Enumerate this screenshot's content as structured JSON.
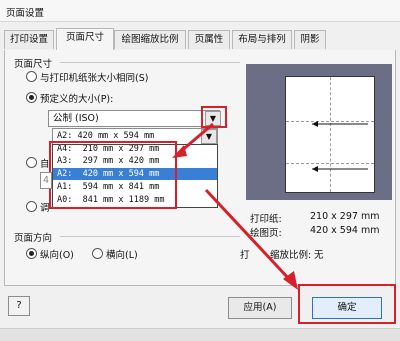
{
  "window": {
    "title": "页面设置"
  },
  "tabs": [
    "打印设置",
    "页面尺寸",
    "绘图缩放比例",
    "页属性",
    "布局与排列",
    "阴影"
  ],
  "active_tab_index": 1,
  "page_size": {
    "group_label": "页面尺寸",
    "option_same_as_printer": "与打印机纸张大小相同(S)",
    "option_predefined": "预定义的大小(P):",
    "predefined_selected": true,
    "standard_combo_value": "公制 (ISO)",
    "size_combo_value": "A2:  420 mm x 594 mm",
    "size_options": [
      "A4:  210 mm x 297 mm",
      "A3:  297 mm x 420 mm",
      "A2:  420 mm x 594 mm",
      "A1:  594 mm x 841 mm",
      "A0:  841 mm x 1189 mm"
    ],
    "selected_option_index": 2,
    "option_custom_prefix": "自",
    "custom_field_prefix": "4",
    "option_adjust_prefix": "调"
  },
  "orientation": {
    "group_label": "页面方向",
    "portrait": "纵向(O)",
    "landscape": "横向(L)",
    "portrait_selected": true
  },
  "info": {
    "printer_paper_label": "打印纸:",
    "printer_paper_value": "210 x 297 mm",
    "drawing_page_label": "绘图页:",
    "drawing_page_value": "420 x 594 mm",
    "scale_label_prefix": "打",
    "scale_label_rest": "缩放比例:",
    "scale_value": "无"
  },
  "buttons": {
    "help": "?",
    "apply": "应用(A)",
    "ok": "确定"
  },
  "colors": {
    "annotation_red": "#d8202a",
    "selection_blue": "#3a7fd6",
    "preview_bg": "#6c6e86"
  }
}
